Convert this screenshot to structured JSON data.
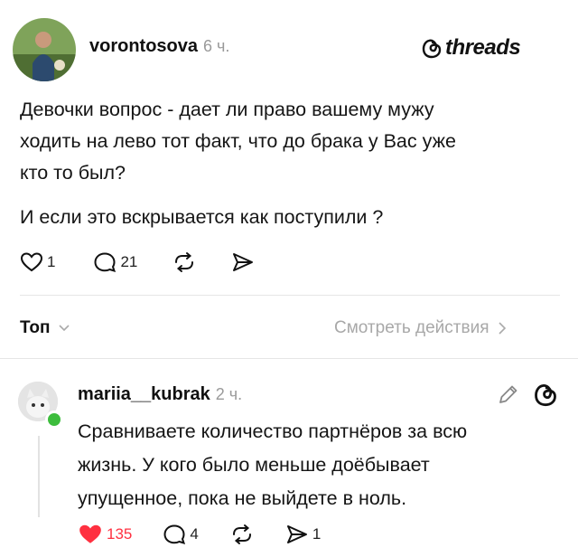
{
  "brand": {
    "logo_text": "threads"
  },
  "post": {
    "author": "vorontosova",
    "time": "6 ч.",
    "lines": [
      "Девочки вопрос - дает ли право вашему мужу",
      "ходить на лево тот факт, что до брака у Вас уже",
      "кто то был?"
    ],
    "line_extra": "И если это вскрывается как поступили ?",
    "likes": "1",
    "replies": "21"
  },
  "sort": {
    "label": "Топ",
    "view_activity": "Смотреть действия"
  },
  "reply": {
    "author": "mariia__kubrak",
    "time": "2 ч.",
    "lines": [
      "Сравниваете количество партнёров за всю",
      "жизнь. У кого было меньше доёбывает",
      "упущенное, пока не выйдете в ноль."
    ],
    "likes": "135",
    "replies": "4",
    "shares": "1"
  },
  "colors": {
    "like_active": "#ff3040",
    "online": "#3dbd3d",
    "muted": "#a8a8a8"
  }
}
